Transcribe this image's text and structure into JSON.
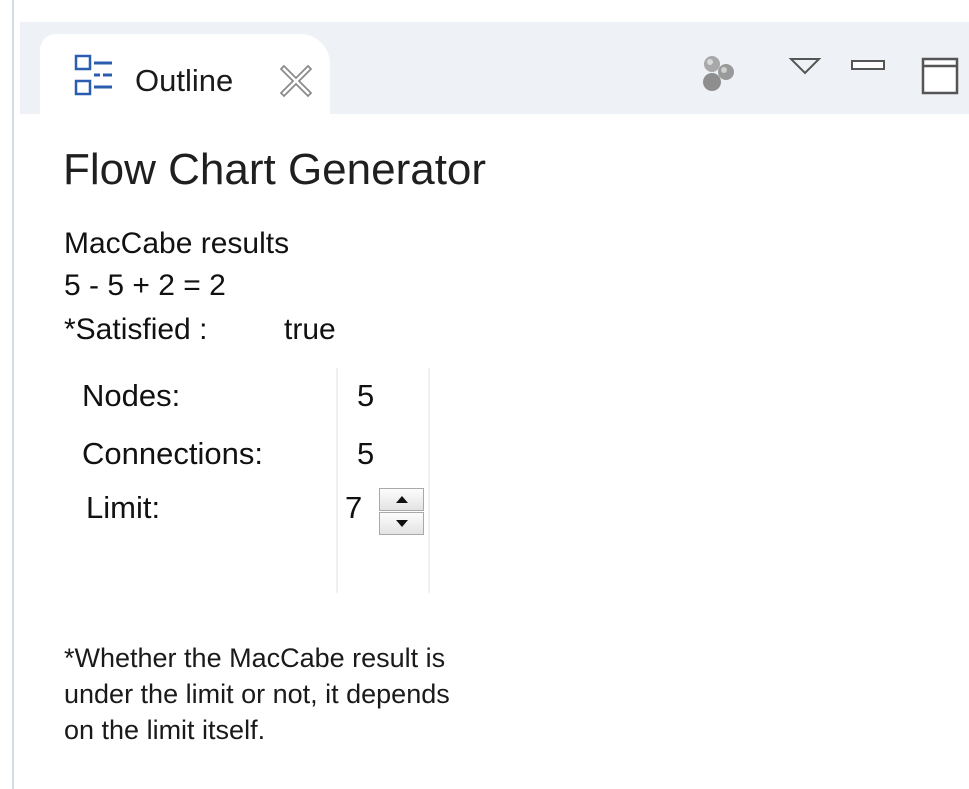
{
  "tab": {
    "label": "Outline",
    "icon": "outline-icon",
    "close_icon": "close-icon"
  },
  "toolbar": {
    "icons": [
      "filter-icon",
      "view-menu-icon",
      "minimize-icon",
      "maximize-icon"
    ]
  },
  "content": {
    "title": "Flow Chart Generator",
    "results_heading": "MacCabe results",
    "formula": "5 - 5 + 2 = 2",
    "satisfied_label": "*Satisfied :",
    "satisfied_value": "true",
    "nodes_label": "Nodes:",
    "nodes_value": "5",
    "connections_label": "Connections:",
    "connections_value": "5",
    "limit_label": "Limit:",
    "limit_value": "7",
    "note_lines": [
      "*Whether the MacCabe result is",
      "under the limit or not, it depends",
      "on the limit itself."
    ]
  },
  "colors": {
    "header_background": "#eef2f7",
    "tab_background": "#ffffff",
    "icon_blue": "#2a5db0"
  }
}
